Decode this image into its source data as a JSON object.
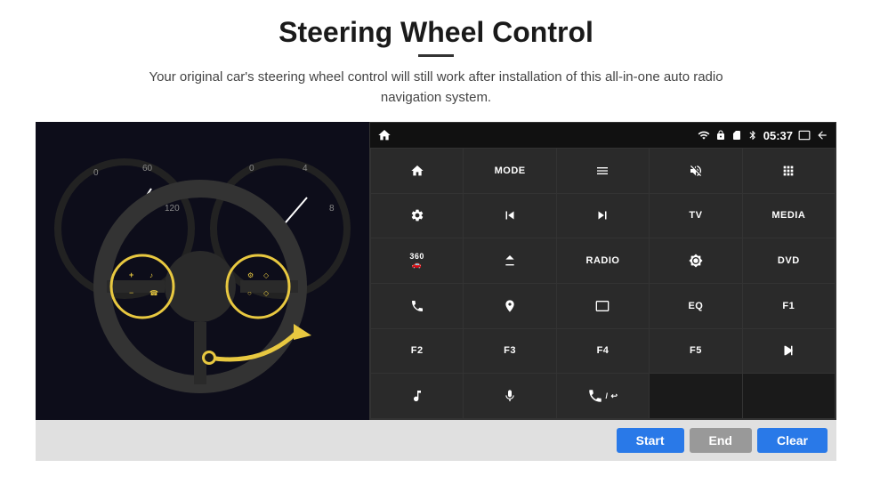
{
  "header": {
    "title": "Steering Wheel Control",
    "subtitle": "Your original car's steering wheel control will still work after installation of this all-in-one auto radio navigation system."
  },
  "status_bar": {
    "time": "05:37",
    "wifi_icon": "wifi",
    "lock_icon": "lock",
    "sim_icon": "sim",
    "bt_icon": "bluetooth",
    "screen_icon": "screen",
    "back_icon": "back",
    "home_icon": "home"
  },
  "grid_buttons": [
    {
      "id": "r1c1",
      "label": "",
      "icon": "home",
      "type": "icon"
    },
    {
      "id": "r1c2",
      "label": "MODE",
      "icon": "",
      "type": "text"
    },
    {
      "id": "r1c3",
      "label": "",
      "icon": "menu",
      "type": "icon"
    },
    {
      "id": "r1c4",
      "label": "",
      "icon": "mute",
      "type": "icon"
    },
    {
      "id": "r1c5",
      "label": "",
      "icon": "dots",
      "type": "icon"
    },
    {
      "id": "r2c1",
      "label": "",
      "icon": "settings",
      "type": "icon"
    },
    {
      "id": "r2c2",
      "label": "",
      "icon": "rewind",
      "type": "icon"
    },
    {
      "id": "r2c3",
      "label": "",
      "icon": "forward",
      "type": "icon"
    },
    {
      "id": "r2c4",
      "label": "TV",
      "icon": "",
      "type": "text"
    },
    {
      "id": "r2c5",
      "label": "MEDIA",
      "icon": "",
      "type": "text"
    },
    {
      "id": "r3c1",
      "label": "",
      "icon": "360cam",
      "type": "icon"
    },
    {
      "id": "r3c2",
      "label": "",
      "icon": "eject",
      "type": "icon"
    },
    {
      "id": "r3c3",
      "label": "RADIO",
      "icon": "",
      "type": "text"
    },
    {
      "id": "r3c4",
      "label": "",
      "icon": "brightness",
      "type": "icon"
    },
    {
      "id": "r3c5",
      "label": "DVD",
      "icon": "",
      "type": "text"
    },
    {
      "id": "r4c1",
      "label": "",
      "icon": "phone",
      "type": "icon"
    },
    {
      "id": "r4c2",
      "label": "",
      "icon": "nav",
      "type": "icon"
    },
    {
      "id": "r4c3",
      "label": "",
      "icon": "screen-rect",
      "type": "icon"
    },
    {
      "id": "r4c4",
      "label": "EQ",
      "icon": "",
      "type": "text"
    },
    {
      "id": "r4c5",
      "label": "F1",
      "icon": "",
      "type": "text"
    },
    {
      "id": "r5c1",
      "label": "F2",
      "icon": "",
      "type": "text"
    },
    {
      "id": "r5c2",
      "label": "F3",
      "icon": "",
      "type": "text"
    },
    {
      "id": "r5c3",
      "label": "F4",
      "icon": "",
      "type": "text"
    },
    {
      "id": "r5c4",
      "label": "F5",
      "icon": "",
      "type": "text"
    },
    {
      "id": "r5c5",
      "label": "",
      "icon": "playpause",
      "type": "icon"
    },
    {
      "id": "r6c1",
      "label": "",
      "icon": "music",
      "type": "icon"
    },
    {
      "id": "r6c2",
      "label": "",
      "icon": "mic",
      "type": "icon"
    },
    {
      "id": "r6c3",
      "label": "",
      "icon": "answer",
      "type": "icon"
    },
    {
      "id": "r6c4",
      "label": "",
      "icon": "empty",
      "type": "empty"
    },
    {
      "id": "r6c5",
      "label": "",
      "icon": "empty",
      "type": "empty"
    }
  ],
  "bottom_buttons": {
    "start": "Start",
    "end": "End",
    "clear": "Clear"
  },
  "colors": {
    "accent_blue": "#2979e8",
    "panel_bg": "#1a1a1a",
    "btn_bg": "#2a2a2a",
    "status_bg": "#111",
    "bottom_bar": "#e0e0e0"
  }
}
